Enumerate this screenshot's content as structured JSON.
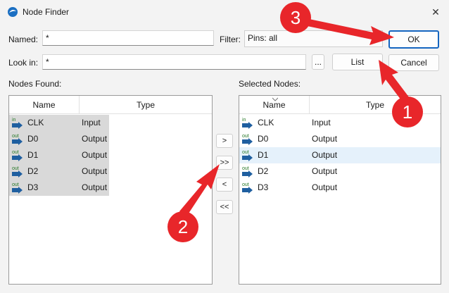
{
  "window": {
    "title": "Node Finder",
    "close_glyph": "✕"
  },
  "form": {
    "named_label": "Named:",
    "named_value": "*",
    "filter_label": "Filter:",
    "filter_value": "Pins: all",
    "lookin_label": "Look in:",
    "lookin_value": "*",
    "browse_label": "...",
    "list_label": "List",
    "ok_label": "OK",
    "cancel_label": "Cancel"
  },
  "found": {
    "title": "Nodes Found:",
    "col_name": "Name",
    "col_type": "Type",
    "rows": [
      {
        "pin": "in",
        "name": "CLK",
        "type": "Input"
      },
      {
        "pin": "out",
        "name": "D0",
        "type": "Output"
      },
      {
        "pin": "out",
        "name": "D1",
        "type": "Output"
      },
      {
        "pin": "out",
        "name": "D2",
        "type": "Output"
      },
      {
        "pin": "out",
        "name": "D3",
        "type": "Output"
      }
    ]
  },
  "selected": {
    "title": "Selected Nodes:",
    "col_name": "Name",
    "col_type": "Type",
    "highlight_index": 2,
    "rows": [
      {
        "pin": "in",
        "name": "CLK",
        "type": "Input"
      },
      {
        "pin": "out",
        "name": "D0",
        "type": "Output"
      },
      {
        "pin": "out",
        "name": "D1",
        "type": "Output"
      },
      {
        "pin": "out",
        "name": "D2",
        "type": "Output"
      },
      {
        "pin": "out",
        "name": "D3",
        "type": "Output"
      }
    ]
  },
  "transfer": {
    "add_one": ">",
    "add_all": ">>",
    "remove_one": "<",
    "remove_all": "<<"
  },
  "annotations": {
    "one": "1",
    "two": "2",
    "three": "3"
  },
  "colors": {
    "accent": "#1565c0",
    "arrow": "#e8262a",
    "row_selected": "#d9d9d9",
    "row_highlight": "#e5f1fb",
    "pin": "#1f5fa0"
  }
}
